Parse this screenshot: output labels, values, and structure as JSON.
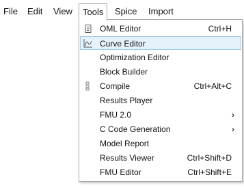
{
  "menubar": {
    "items": [
      {
        "label": "File"
      },
      {
        "label": "Edit"
      },
      {
        "label": "View"
      },
      {
        "label": "Tools"
      },
      {
        "label": "Spice"
      },
      {
        "label": "Import"
      }
    ]
  },
  "tools_menu": {
    "items": [
      {
        "label": "OML Editor",
        "shortcut": "Ctrl+H",
        "icon": "script-icon"
      },
      {
        "label": "Curve Editor",
        "shortcut": "",
        "icon": "curve-icon",
        "highlighted": true
      },
      {
        "label": "Optimization Editor",
        "shortcut": ""
      },
      {
        "label": "Block Builder",
        "shortcut": ""
      },
      {
        "label": "Compile",
        "shortcut": "Ctrl+Alt+C",
        "icon": "compile-icon"
      },
      {
        "label": "Results Player",
        "shortcut": ""
      },
      {
        "label": "FMU 2.0",
        "shortcut": "",
        "submenu": true
      },
      {
        "label": "C Code Generation",
        "shortcut": "",
        "submenu": true
      },
      {
        "label": "Model Report",
        "shortcut": ""
      },
      {
        "label": "Results Viewer",
        "shortcut": "Ctrl+Shift+D"
      },
      {
        "label": "FMU Editor",
        "shortcut": "Ctrl+Shift+E"
      }
    ]
  },
  "colors": {
    "highlight_bg": "#e5f1fb",
    "highlight_border": "#99c9ef",
    "menu_border": "#a9a9a9"
  }
}
